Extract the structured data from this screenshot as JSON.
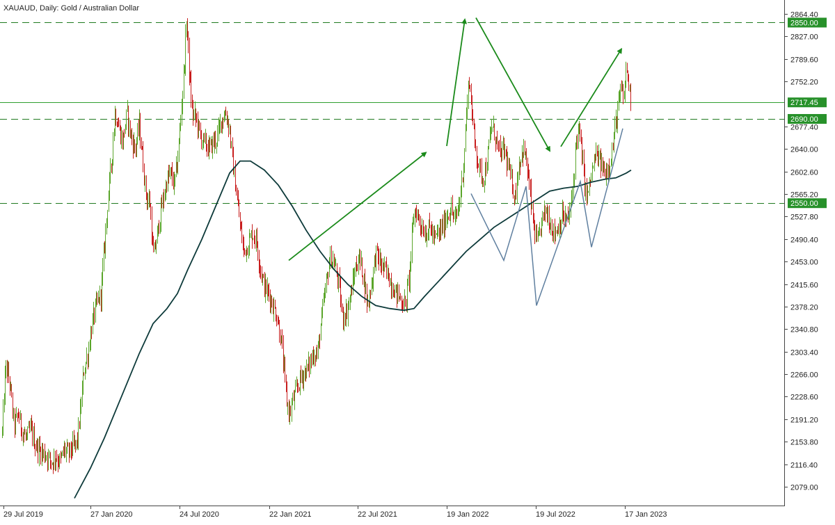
{
  "chart_data": {
    "type": "candlestick",
    "title": "XAUAUD, Daily:  Gold / Australian Dollar",
    "ylim": [
      2055,
      2875
    ],
    "y_ticks": [
      2864.4,
      2827.0,
      2789.6,
      2752.2,
      2717.45,
      2677.4,
      2640.0,
      2602.6,
      2565.2,
      2527.8,
      2490.4,
      2453.0,
      2415.6,
      2378.2,
      2340.8,
      2303.4,
      2266.0,
      2228.6,
      2191.2,
      2153.8,
      2116.4,
      2079.0
    ],
    "x_labels": [
      "29 Jul 2019",
      "27 Jan 2020",
      "24 Jul 2020",
      "22 Jan 2021",
      "22 Jul 2021",
      "19 Jan 2022",
      "19 Jul 2022",
      "17 Jan 2023"
    ],
    "levels": [
      {
        "value": 2850.0,
        "label": "2850.00",
        "style": "dashed",
        "color": "#1f7a1f"
      },
      {
        "value": 2717.45,
        "label": "2717.45",
        "style": "solid",
        "color": "#2e9e2e"
      },
      {
        "value": 2690.0,
        "label": "2690.00",
        "style": "dashed",
        "color": "#1f7a1f"
      },
      {
        "value": 2550.0,
        "label": "2550.00",
        "style": "dashed",
        "color": "#1f7a1f"
      }
    ],
    "price_path": [
      [
        0,
        2060
      ],
      [
        3,
        2170
      ],
      [
        8,
        2280
      ],
      [
        14,
        2250
      ],
      [
        20,
        2180
      ],
      [
        26,
        2200
      ],
      [
        32,
        2170
      ],
      [
        38,
        2160
      ],
      [
        44,
        2175
      ],
      [
        50,
        2150
      ],
      [
        56,
        2140
      ],
      [
        62,
        2135
      ],
      [
        68,
        2130
      ],
      [
        74,
        2120
      ],
      [
        80,
        2130
      ],
      [
        86,
        2120
      ],
      [
        92,
        2140
      ],
      [
        98,
        2135
      ],
      [
        104,
        2145
      ],
      [
        110,
        2150
      ],
      [
        115,
        2200
      ],
      [
        120,
        2270
      ],
      [
        126,
        2300
      ],
      [
        132,
        2350
      ],
      [
        138,
        2380
      ],
      [
        145,
        2400
      ],
      [
        150,
        2480
      ],
      [
        155,
        2560
      ],
      [
        160,
        2620
      ],
      [
        165,
        2700
      ],
      [
        170,
        2680
      ],
      [
        176,
        2650
      ],
      [
        182,
        2700
      ],
      [
        188,
        2660
      ],
      [
        194,
        2640
      ],
      [
        200,
        2680
      ],
      [
        205,
        2620
      ],
      [
        210,
        2560
      ],
      [
        215,
        2550
      ],
      [
        220,
        2460
      ],
      [
        225,
        2490
      ],
      [
        230,
        2530
      ],
      [
        235,
        2560
      ],
      [
        240,
        2590
      ],
      [
        245,
        2600
      ],
      [
        250,
        2580
      ],
      [
        255,
        2620
      ],
      [
        260,
        2700
      ],
      [
        265,
        2790
      ],
      [
        268,
        2860
      ],
      [
        272,
        2760
      ],
      [
        276,
        2700
      ],
      [
        282,
        2690
      ],
      [
        288,
        2660
      ],
      [
        294,
        2650
      ],
      [
        300,
        2640
      ],
      [
        306,
        2650
      ],
      [
        312,
        2660
      ],
      [
        318,
        2690
      ],
      [
        324,
        2700
      ],
      [
        330,
        2670
      ],
      [
        334,
        2620
      ],
      [
        338,
        2580
      ],
      [
        342,
        2540
      ],
      [
        346,
        2500
      ],
      [
        350,
        2470
      ],
      [
        356,
        2480
      ],
      [
        362,
        2500
      ],
      [
        368,
        2490
      ],
      [
        374,
        2440
      ],
      [
        380,
        2410
      ],
      [
        386,
        2400
      ],
      [
        392,
        2380
      ],
      [
        398,
        2360
      ],
      [
        404,
        2320
      ],
      [
        408,
        2270
      ],
      [
        412,
        2220
      ],
      [
        416,
        2200
      ],
      [
        420,
        2220
      ],
      [
        426,
        2240
      ],
      [
        432,
        2260
      ],
      [
        438,
        2270
      ],
      [
        444,
        2280
      ],
      [
        450,
        2300
      ],
      [
        456,
        2300
      ],
      [
        462,
        2360
      ],
      [
        468,
        2410
      ],
      [
        474,
        2460
      ],
      [
        480,
        2450
      ],
      [
        486,
        2420
      ],
      [
        492,
        2360
      ],
      [
        498,
        2370
      ],
      [
        504,
        2400
      ],
      [
        510,
        2440
      ],
      [
        516,
        2460
      ],
      [
        522,
        2430
      ],
      [
        528,
        2380
      ],
      [
        534,
        2420
      ],
      [
        540,
        2470
      ],
      [
        546,
        2450
      ],
      [
        552,
        2440
      ],
      [
        558,
        2430
      ],
      [
        564,
        2410
      ],
      [
        570,
        2400
      ],
      [
        576,
        2390
      ],
      [
        582,
        2380
      ],
      [
        588,
        2430
      ],
      [
        592,
        2500
      ],
      [
        596,
        2540
      ],
      [
        600,
        2530
      ],
      [
        606,
        2510
      ],
      [
        612,
        2500
      ],
      [
        618,
        2510
      ],
      [
        624,
        2490
      ],
      [
        630,
        2500
      ],
      [
        636,
        2510
      ],
      [
        642,
        2530
      ],
      [
        648,
        2540
      ],
      [
        654,
        2520
      ],
      [
        658,
        2540
      ],
      [
        662,
        2570
      ],
      [
        666,
        2620
      ],
      [
        670,
        2700
      ],
      [
        674,
        2760
      ],
      [
        678,
        2700
      ],
      [
        682,
        2650
      ],
      [
        688,
        2610
      ],
      [
        694,
        2590
      ],
      [
        700,
        2620
      ],
      [
        706,
        2680
      ],
      [
        712,
        2660
      ],
      [
        718,
        2630
      ],
      [
        724,
        2640
      ],
      [
        730,
        2610
      ],
      [
        736,
        2580
      ],
      [
        740,
        2560
      ],
      [
        746,
        2620
      ],
      [
        752,
        2640
      ],
      [
        756,
        2620
      ],
      [
        762,
        2560
      ],
      [
        768,
        2500
      ],
      [
        772,
        2480
      ],
      [
        778,
        2520
      ],
      [
        784,
        2540
      ],
      [
        790,
        2520
      ],
      [
        796,
        2500
      ],
      [
        802,
        2510
      ],
      [
        808,
        2530
      ],
      [
        814,
        2520
      ],
      [
        820,
        2540
      ],
      [
        824,
        2590
      ],
      [
        828,
        2660
      ],
      [
        832,
        2670
      ],
      [
        836,
        2630
      ],
      [
        840,
        2580
      ],
      [
        844,
        2560
      ],
      [
        850,
        2600
      ],
      [
        856,
        2630
      ],
      [
        862,
        2620
      ],
      [
        868,
        2600
      ],
      [
        874,
        2610
      ],
      [
        880,
        2640
      ],
      [
        884,
        2680
      ],
      [
        888,
        2710
      ],
      [
        892,
        2740
      ],
      [
        896,
        2720
      ],
      [
        900,
        2780
      ],
      [
        904,
        2740
      ],
      [
        907,
        2717
      ]
    ],
    "moving_average": [
      [
        107,
        2060
      ],
      [
        130,
        2110
      ],
      [
        150,
        2160
      ],
      [
        175,
        2230
      ],
      [
        200,
        2300
      ],
      [
        220,
        2350
      ],
      [
        240,
        2375
      ],
      [
        255,
        2400
      ],
      [
        270,
        2440
      ],
      [
        290,
        2490
      ],
      [
        310,
        2545
      ],
      [
        330,
        2600
      ],
      [
        345,
        2620
      ],
      [
        360,
        2620
      ],
      [
        380,
        2605
      ],
      [
        400,
        2580
      ],
      [
        420,
        2545
      ],
      [
        440,
        2505
      ],
      [
        460,
        2470
      ],
      [
        480,
        2440
      ],
      [
        500,
        2415
      ],
      [
        520,
        2395
      ],
      [
        540,
        2380
      ],
      [
        560,
        2375
      ],
      [
        580,
        2372
      ],
      [
        595,
        2375
      ],
      [
        610,
        2395
      ],
      [
        630,
        2420
      ],
      [
        650,
        2445
      ],
      [
        670,
        2470
      ],
      [
        690,
        2490
      ],
      [
        710,
        2510
      ],
      [
        730,
        2525
      ],
      [
        750,
        2540
      ],
      [
        770,
        2555
      ],
      [
        790,
        2570
      ],
      [
        810,
        2575
      ],
      [
        830,
        2578
      ],
      [
        850,
        2585
      ],
      [
        870,
        2590
      ],
      [
        885,
        2592
      ],
      [
        900,
        2600
      ],
      [
        907,
        2605
      ]
    ],
    "arrows": [
      [
        [
          415,
          2455
        ],
        [
          612,
          2634
        ]
      ],
      [
        [
          642,
          2645
        ],
        [
          668,
          2855
        ]
      ],
      [
        [
          684,
          2858
        ],
        [
          790,
          2637
        ]
      ],
      [
        [
          806,
          2644
        ],
        [
          893,
          2806
        ]
      ]
    ],
    "pattern_lines": [
      [
        [
          677,
          2566
        ],
        [
          724,
          2455
        ],
        [
          756,
          2578
        ],
        [
          771,
          2380
        ],
        [
          834,
          2586
        ],
        [
          850,
          2477
        ],
        [
          895,
          2674
        ]
      ]
    ],
    "colors": {
      "up": "#5aa52a",
      "down": "#c81e1e",
      "ma": "#0d3a3a",
      "arrow": "#1a8a1a",
      "pattern": "#5f7f9f",
      "label_bg": "#27912a"
    }
  }
}
